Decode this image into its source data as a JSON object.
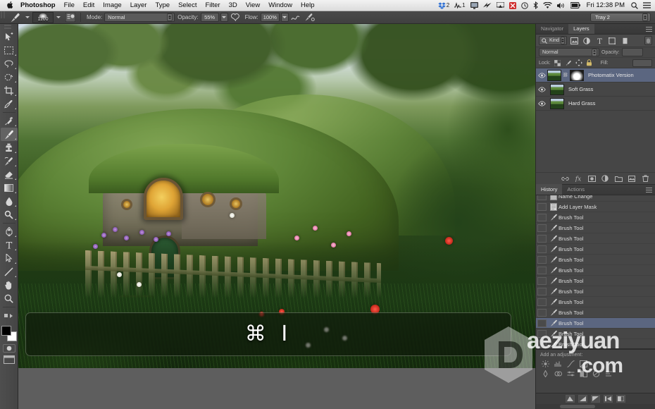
{
  "menubar": {
    "apple_icon": "apple-icon",
    "items": [
      {
        "label": "Photoshop",
        "bold": true
      },
      {
        "label": "File",
        "bold": false
      },
      {
        "label": "Edit",
        "bold": false
      },
      {
        "label": "Image",
        "bold": false
      },
      {
        "label": "Layer",
        "bold": false
      },
      {
        "label": "Type",
        "bold": false
      },
      {
        "label": "Select",
        "bold": false
      },
      {
        "label": "Filter",
        "bold": false
      },
      {
        "label": "3D",
        "bold": false
      },
      {
        "label": "View",
        "bold": false
      },
      {
        "label": "Window",
        "bold": false
      },
      {
        "label": "Help",
        "bold": false
      }
    ],
    "status": {
      "dropbox_badge": "2",
      "chart_badge": "1",
      "clock": "Fri 12:38 PM",
      "icons": [
        "dropbox-icon",
        "activity-icon",
        "display-icon",
        "fastscripts-icon",
        "airplay-icon",
        "alert-icon",
        "timemachine-icon",
        "bluetooth-icon",
        "wifi-icon",
        "volume-icon",
        "battery-icon",
        "spotlight-icon",
        "notification-center-icon"
      ]
    }
  },
  "options_bar": {
    "tool_icon": "brush-tool-icon",
    "brush_size": "1100",
    "brush_preset_icon": "brush-preset-picker-icon",
    "mode_label": "Mode:",
    "mode_value": "Normal",
    "opacity_label": "Opacity:",
    "opacity_value": "55%",
    "airbrush_icon": "airbrush-icon",
    "flow_label": "Flow:",
    "flow_value": "100%",
    "smoothing_icon": "smoothing-icon",
    "tablet_pressure_icon": "tablet-pressure-icon",
    "workspace": "Tray 2"
  },
  "toolbar": {
    "tools": [
      {
        "name": "move-tool",
        "active": false
      },
      {
        "name": "marquee-tool",
        "active": false
      },
      {
        "name": "lasso-tool",
        "active": false
      },
      {
        "name": "quick-selection-tool",
        "active": false
      },
      {
        "name": "crop-tool",
        "active": false
      },
      {
        "name": "eyedropper-tool",
        "active": false
      },
      {
        "name": "spot-healing-brush-tool",
        "active": false
      },
      {
        "name": "brush-tool",
        "active": true
      },
      {
        "name": "clone-stamp-tool",
        "active": false
      },
      {
        "name": "history-brush-tool",
        "active": false
      },
      {
        "name": "eraser-tool",
        "active": false
      },
      {
        "name": "gradient-tool",
        "active": false
      },
      {
        "name": "blur-tool",
        "active": false
      },
      {
        "name": "dodge-tool",
        "active": false
      },
      {
        "name": "pen-tool",
        "active": false
      },
      {
        "name": "type-tool",
        "active": false
      },
      {
        "name": "path-selection-tool",
        "active": false
      },
      {
        "name": "line-shape-tool",
        "active": false
      },
      {
        "name": "hand-tool",
        "active": false
      },
      {
        "name": "zoom-tool",
        "active": false
      }
    ],
    "foreground_color": "#000000",
    "background_color": "#ffffff",
    "quickmask_icon": "quick-mask-icon",
    "screenmode_icon": "screen-mode-icon"
  },
  "canvas": {
    "image_description": "hobbit-house-garden-photo",
    "key_overlay": "⌘ I"
  },
  "layers_panel": {
    "tabs": [
      {
        "label": "Navigator",
        "active": false
      },
      {
        "label": "Layers",
        "active": true
      }
    ],
    "filter_kind": "Kind",
    "filter_icons": [
      "pixel-filter-icon",
      "adjustment-filter-icon",
      "type-filter-icon",
      "shape-filter-icon",
      "smartobject-filter-icon"
    ],
    "blend_mode": "Normal",
    "opacity_label": "Opacity:",
    "opacity_value": "",
    "lock_label": "Lock:",
    "lock_icons": [
      "lock-transparency-icon",
      "lock-image-icon",
      "lock-position-icon",
      "lock-all-icon"
    ],
    "fill_label": "Fill:",
    "fill_value": "",
    "layers": [
      {
        "name": "Photomatix Version",
        "visible": true,
        "selected": true,
        "has_mask": true
      },
      {
        "name": "Soft Grass",
        "visible": true,
        "selected": false,
        "has_mask": false
      },
      {
        "name": "Hard Grass",
        "visible": true,
        "selected": false,
        "has_mask": false
      }
    ],
    "footer_icons": [
      "link-layers-icon",
      "layer-style-fx-icon",
      "add-layer-mask-icon",
      "new-adjustment-layer-icon",
      "new-group-icon",
      "new-layer-icon",
      "delete-layer-icon"
    ]
  },
  "history_panel": {
    "tabs": [
      {
        "label": "History",
        "active": true
      },
      {
        "label": "Actions",
        "active": false
      }
    ],
    "entries": [
      {
        "label": "Name Change",
        "icon": "name-change-icon",
        "active": false
      },
      {
        "label": "Add Layer Mask",
        "icon": "add-layer-mask-icon",
        "active": false
      },
      {
        "label": "Brush Tool",
        "icon": "brush-tool-icon",
        "active": false
      },
      {
        "label": "Brush Tool",
        "icon": "brush-tool-icon",
        "active": false
      },
      {
        "label": "Brush Tool",
        "icon": "brush-tool-icon",
        "active": false
      },
      {
        "label": "Brush Tool",
        "icon": "brush-tool-icon",
        "active": false
      },
      {
        "label": "Brush Tool",
        "icon": "brush-tool-icon",
        "active": false
      },
      {
        "label": "Brush Tool",
        "icon": "brush-tool-icon",
        "active": false
      },
      {
        "label": "Brush Tool",
        "icon": "brush-tool-icon",
        "active": false
      },
      {
        "label": "Brush Tool",
        "icon": "brush-tool-icon",
        "active": false
      },
      {
        "label": "Brush Tool",
        "icon": "brush-tool-icon",
        "active": false
      },
      {
        "label": "Brush Tool",
        "icon": "brush-tool-icon",
        "active": false
      },
      {
        "label": "Brush Tool",
        "icon": "brush-tool-icon",
        "active": true
      },
      {
        "label": "Brush Tool",
        "icon": "brush-tool-icon",
        "active": false
      },
      {
        "label": "Brush Tool",
        "icon": "brush-tool-icon",
        "active": false
      }
    ]
  },
  "adjustments_panel": {
    "title": "Add an adjustment:",
    "row1_icons": [
      "brightness-contrast-icon",
      "levels-icon",
      "curves-icon",
      "exposure-icon"
    ],
    "row2_icons": [
      "vibrance-icon",
      "hue-saturation-icon",
      "color-balance-icon",
      "black-white-icon",
      "photo-filter-icon",
      "channel-mixer-icon"
    ]
  },
  "watermark": {
    "logo": "cube-logo-icon",
    "text_line1": "aeziyuan",
    "text_line2": ".com"
  },
  "colors": {
    "chrome": "#464646",
    "chrome_dark": "#3b3b3b",
    "selection_blue": "#5b6680",
    "menubar_bg": "#eeeeee",
    "text_light": "#e6e6e6"
  }
}
